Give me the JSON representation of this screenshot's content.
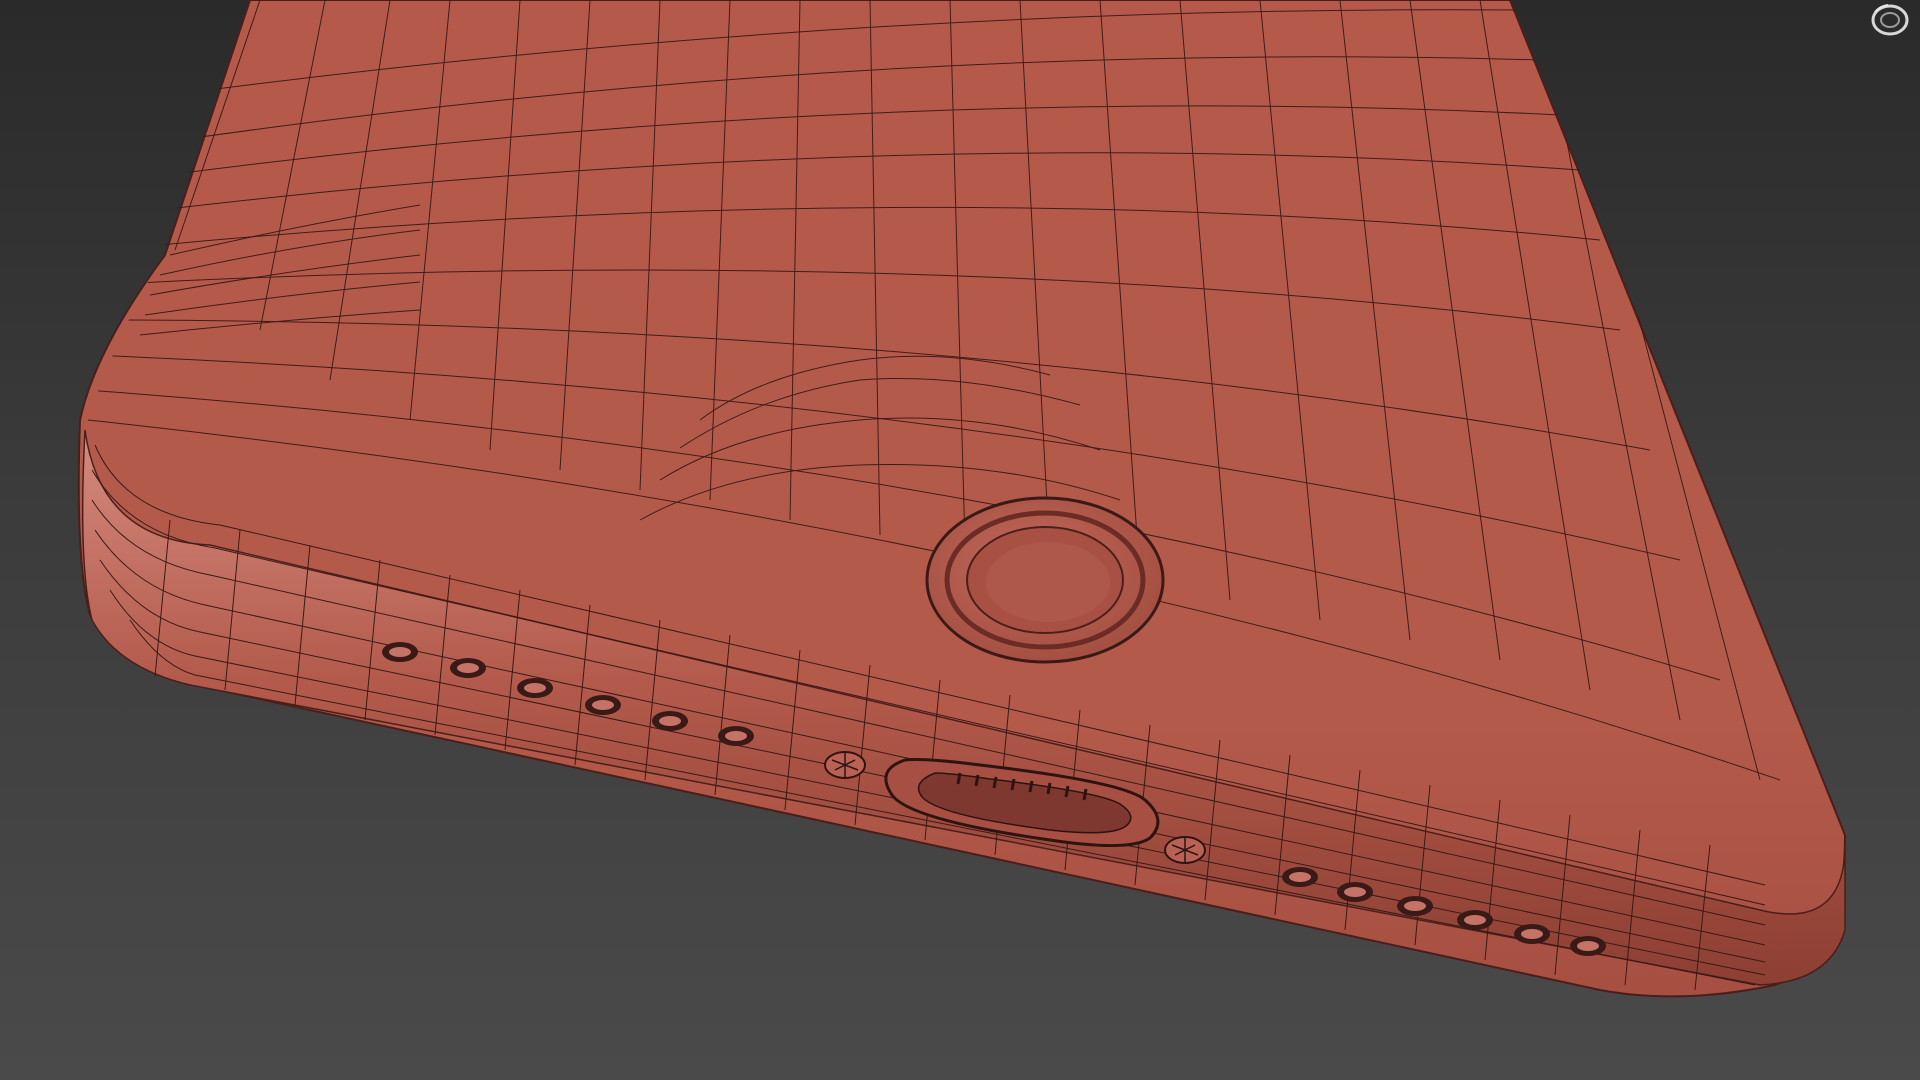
{
  "viewport": {
    "background_top": "#2a2a2a",
    "background_bottom": "#4a4a4a"
  },
  "model": {
    "shell_color": "#b55a4b",
    "shell_shadow": "#8d3f33",
    "shell_highlight": "#d48b7f",
    "wire_color": "#3a1a16",
    "port_color": "#c57367"
  },
  "navigation": {
    "viewcube_icon": "viewcube-ring-icon"
  }
}
